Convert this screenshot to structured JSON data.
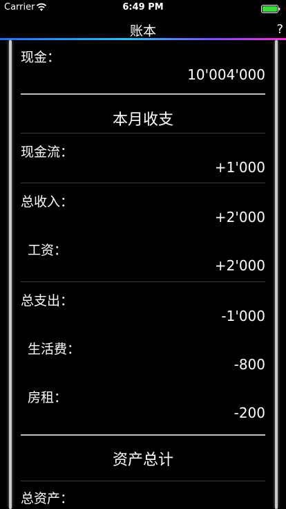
{
  "status_bar": {
    "carrier": "Carrier",
    "time": "6:49 PM"
  },
  "nav": {
    "title": "账本",
    "help_label": "?"
  },
  "cash": {
    "label": "现金：",
    "amount": "10'004'000"
  },
  "monthly": {
    "title": "本月收支",
    "cash_flow": {
      "label": "现金流：",
      "amount": "+1'000"
    },
    "income_total": {
      "label": "总收入：",
      "amount": "+2'000"
    },
    "salary": {
      "label": "工资：",
      "amount": "+2'000"
    },
    "expense_total": {
      "label": "总支出：",
      "amount": "-1'000"
    },
    "living": {
      "label": "生活费：",
      "amount": "-800"
    },
    "rent": {
      "label": "房租：",
      "amount": "-200"
    }
  },
  "assets": {
    "title": "资产总计",
    "total": {
      "label": "总资产："
    }
  }
}
